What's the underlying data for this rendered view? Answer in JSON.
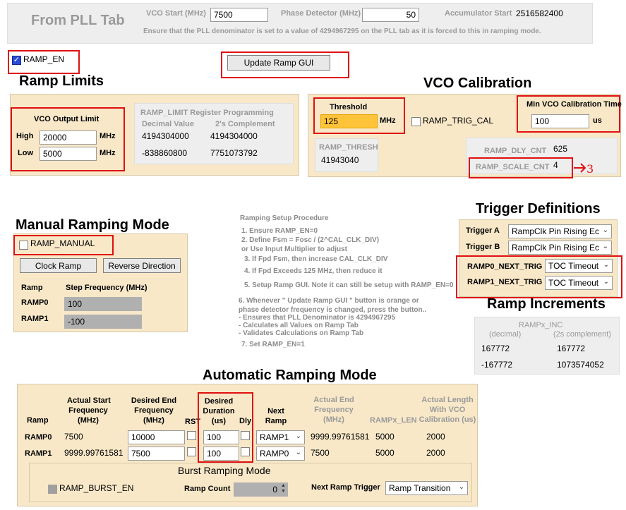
{
  "pll_tab": {
    "title": "From PLL Tab",
    "vco_start_label": "VCO Start (MHz)",
    "vco_start_value": "7500",
    "phase_detector_label": "Phase Detector (MHz)",
    "phase_detector_value": "50",
    "accumulator_start_label": "Accumulator Start",
    "accumulator_start_value": "2516582400",
    "note": "Ensure that the PLL denominator is set to a value of 4294967295 on the PLL tab as it is forced to this in ramping mode."
  },
  "ramp_en": {
    "label": "RAMP_EN",
    "checked": true
  },
  "update_button": "Update Ramp GUI",
  "ramp_limits": {
    "title": "Ramp Limits",
    "vco_output_limit": "VCO Output Limit",
    "high_label": "High",
    "high_value": "20000",
    "low_label": "Low",
    "low_value": "5000",
    "unit": "MHz",
    "register_title": "RAMP_LIMIT Register Programming",
    "decimal_label": "Decimal Value",
    "twos_label": "2's Complement",
    "high_decimal": "4194304000",
    "high_twos": "4194304000",
    "low_decimal": "-838860800",
    "low_twos": "7751073792"
  },
  "vco_cal": {
    "title": "VCO Calibration",
    "threshold_label": "Threshold",
    "threshold_value": "125",
    "threshold_unit": "MHz",
    "trig_cal_label": "RAMP_TRIG_CAL",
    "min_time_label": "Min VCO Calibration Time",
    "min_time_value": "100",
    "min_time_unit": "us",
    "ramp_thresh_label": "RAMP_THRESH",
    "ramp_thresh_value": "41943040",
    "dly_cnt_label": "RAMP_DLY_CNT",
    "dly_cnt_value": "625",
    "scale_cnt_label": "RAMP_SCALE_CNT",
    "scale_cnt_value": "4",
    "annotation": "3"
  },
  "manual": {
    "title": "Manual Ramping Mode",
    "ramp_manual_label": "RAMP_MANUAL",
    "clock_ramp": "Clock Ramp",
    "reverse_direction": "Reverse Direction",
    "ramp_col": "Ramp",
    "step_col": "Step Frequency (MHz)",
    "rows": [
      {
        "name": "RAMP0",
        "value": "100"
      },
      {
        "name": "RAMP1",
        "value": "-100"
      }
    ]
  },
  "procedure": {
    "title": "Ramping Setup Procedure",
    "lines": [
      "1.  Ensure RAMP_EN=0",
      "2.  Define  Fsm = Fosc / (2^CAL_CLK_DIV)",
      "      or Use Input Multiplier to adjust",
      "3.  If Fpd   Fsm, then increase CAL_CLK_DIV",
      "4.  If Fpd Exceeds 125 MHz, then reduce it",
      "5.  Setup Ramp GUI.  Note it can still be setup with RAMP_EN=0",
      "6.  Whenever \" Update Ramp GUI \" button is orange or",
      "      phase detector frequency is changed, press the button..",
      "       - Ensures that PLL Denominator is 4294967295",
      "       - Calculates all Values on Ramp Tab",
      "       - Validates Calculations on Ramp Tab",
      "7.  Set RAMP_EN=1"
    ]
  },
  "triggers": {
    "title": "Trigger Definitions",
    "trigger_a_label": "Trigger A",
    "trigger_a_value": "RampClk Pin Rising Ec",
    "trigger_b_label": "Trigger B",
    "trigger_b_value": "RampClk Pin Rising Ec",
    "ramp0_next_label": "RAMP0_NEXT_TRIG",
    "ramp0_next_value": "TOC Timeout",
    "ramp1_next_label": "RAMP1_NEXT_TRIG",
    "ramp1_next_value": "TOC Timeout"
  },
  "increments": {
    "title": "Ramp Increments",
    "header": "RAMPx_INC",
    "col1": "(decimal)",
    "col2": "(2s complement)",
    "rows": [
      {
        "dec": "167772",
        "twos": "167772"
      },
      {
        "dec": "-167772",
        "twos": "1073574052"
      }
    ]
  },
  "automatic": {
    "title": "Automatic Ramping Mode",
    "headers": {
      "ramp": "Ramp",
      "actual_start_1": "Actual Start",
      "actual_start_2": "Frequency",
      "actual_start_3": "(MHz)",
      "desired_end_1": "Desired End",
      "desired_end_2": "Frequency",
      "desired_end_3": "(MHz)",
      "rst": "RST",
      "desired_dur_1": "Desired",
      "desired_dur_2": "Duration",
      "desired_dur_3": "(us)",
      "dly": "Dly",
      "next_1": "Next",
      "next_2": "Ramp",
      "actual_end_1": "Actual End",
      "actual_end_2": "Frequency",
      "actual_end_3": "(MHz)",
      "len": "RAMPx_LEN",
      "actual_len_1": "Actual Length",
      "actual_len_2": "With VCO",
      "actual_len_3": "Calibration (us)"
    },
    "rows": [
      {
        "ramp": "RAMP0",
        "start": "7500",
        "end": "10000",
        "duration": "100",
        "next": "RAMP1",
        "actual_end": "9999.99761581",
        "len": "5000",
        "actual_len": "2000"
      },
      {
        "ramp": "RAMP1",
        "start": "9999.99761581",
        "end": "7500",
        "duration": "100",
        "next": "RAMP0",
        "actual_end": "7500",
        "len": "5000",
        "actual_len": "2000"
      }
    ],
    "burst_title": "Burst Ramping Mode",
    "burst_en_label": "RAMP_BURST_EN",
    "ramp_count_label": "Ramp Count",
    "ramp_count_value": "0",
    "next_trigger_label": "Next Ramp Trigger",
    "next_trigger_value": "Ramp Transition"
  }
}
